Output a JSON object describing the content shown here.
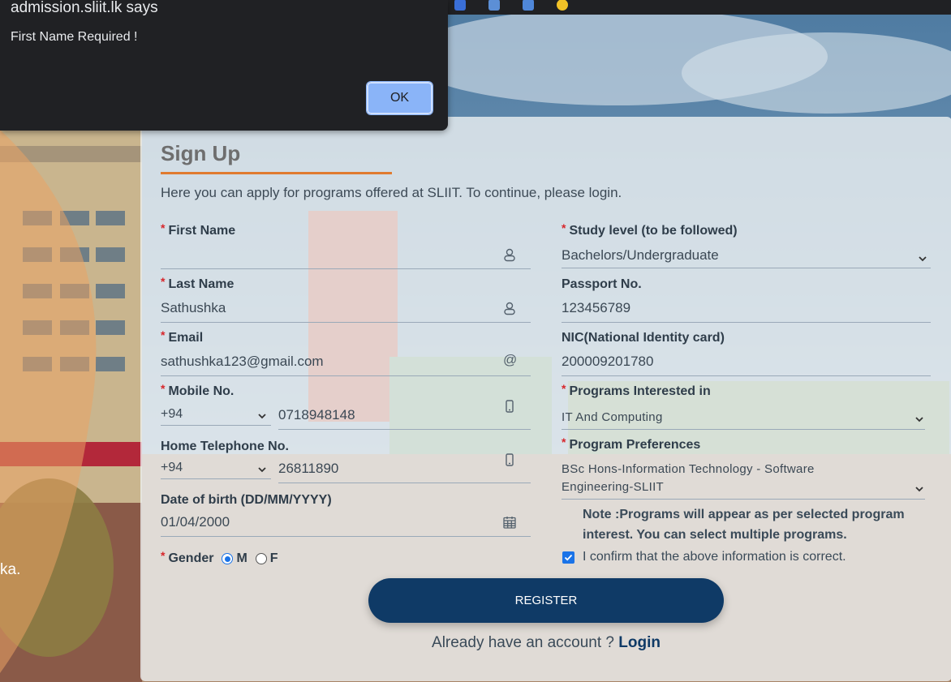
{
  "dialog": {
    "title": "admission.sliit.lk says",
    "message": "First Name Required !",
    "ok_label": "OK"
  },
  "background": {
    "side_text": "ka."
  },
  "form": {
    "title": "Sign Up",
    "subtitle": "Here you can apply for programs offered at SLIIT. To continue, please login.",
    "required_mark": "*",
    "first_name": {
      "label": "First Name",
      "value": "",
      "icon": "user-icon"
    },
    "last_name": {
      "label": "Last Name",
      "value": "Sathushka",
      "icon": "user-icon"
    },
    "email": {
      "label": "Email",
      "value": "sathushka123@gmail.com",
      "icon": "at-icon"
    },
    "mobile": {
      "label": "Mobile No.",
      "country_code": "+94",
      "value": "0718948148",
      "icon": "mobile-icon"
    },
    "home_phone": {
      "label": "Home Telephone No.",
      "country_code": "+94",
      "value": "26811890",
      "icon": "mobile-icon"
    },
    "dob": {
      "label": "Date of birth (DD/MM/YYYY)",
      "value": "01/04/2000",
      "icon": "calendar-icon"
    },
    "gender": {
      "label": "Gender",
      "options": [
        "M",
        "F"
      ],
      "selected": "M"
    },
    "study_level": {
      "label": "Study level (to be followed)",
      "value": "Bachelors/Undergraduate"
    },
    "passport": {
      "label": "Passport No.",
      "value": "123456789"
    },
    "nic": {
      "label": "NIC(National Identity card)",
      "value": "200009201780"
    },
    "programs_interested": {
      "label": "Programs Interested in",
      "value": "IT And Computing"
    },
    "program_preferences": {
      "label": "Program Preferences",
      "value_line1": "BSc Hons-Information Technology - Software",
      "value_line2": "Engineering-SLIIT"
    },
    "note": "Note :Programs will appear as per selected program interest. You can select multiple programs.",
    "confirm": {
      "text": "I confirm that the above information is correct.",
      "checked": true
    },
    "register_label": "REGISTER",
    "login_prompt": "Already have an account ? ",
    "login_label": "Login"
  },
  "colors": {
    "accent_underline": "#e07b2f",
    "button_primary": "#0f3a66",
    "required": "#d7262b",
    "dialog_bg": "#202124",
    "dialog_button": "#8ab4f8"
  }
}
